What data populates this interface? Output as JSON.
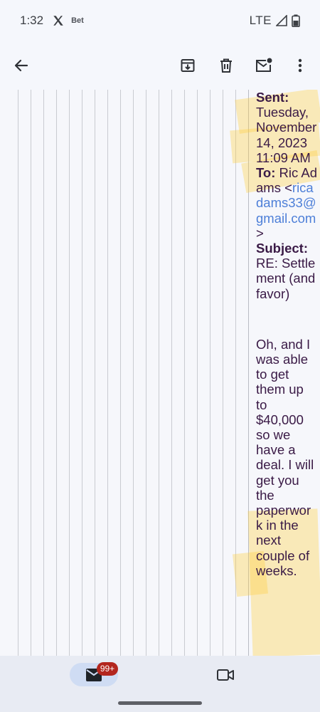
{
  "status_bar": {
    "time": "1:32",
    "notification_app": "Bet",
    "network": "LTE"
  },
  "toolbar": {
    "icons": [
      "back-arrow-icon",
      "archive-icon",
      "delete-icon",
      "mark-unread-icon",
      "more-vert-icon"
    ]
  },
  "email": {
    "sent_label": "Sent:",
    "sent_value": "Tuesday, November 14, 2023 11:09 AM",
    "to_label": "To:",
    "to_name": "Ric Adams",
    "to_open": "<",
    "to_email": "ricadams33@gmail.com",
    "to_close": ">",
    "subject_label": "Subject:",
    "subject_value": "RE: Settlement (and favor)",
    "body": "Oh, and I was able to get them up to $40,000 so we have a deal.  I will get you the paperwork in the next couple of weeks."
  },
  "bottom_nav": {
    "mail_badge": "99+"
  },
  "colors": {
    "highlight": "#ffcd3c",
    "link": "#4d7fd8",
    "badge": "#b3261e",
    "text": "#3a1a46"
  }
}
